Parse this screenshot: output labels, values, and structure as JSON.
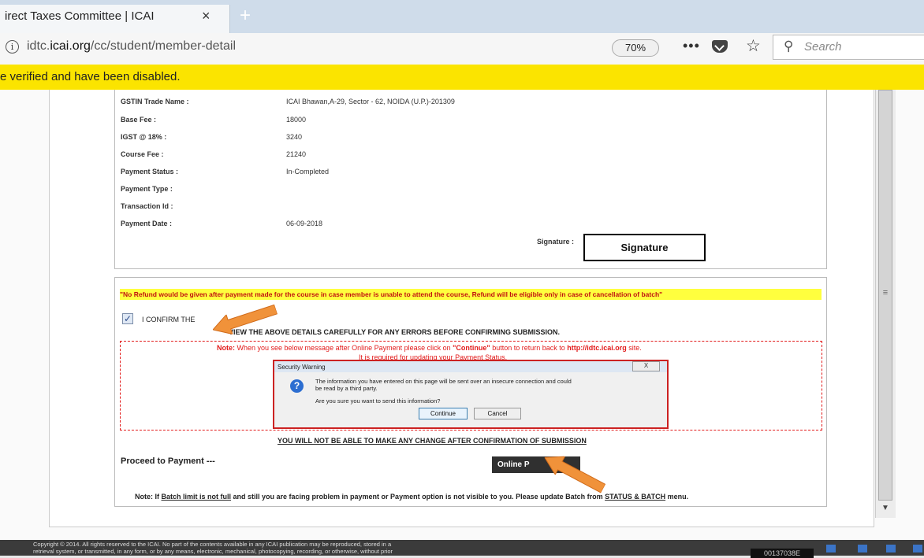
{
  "browser": {
    "tab_title": "irect Taxes Committee | ICAI",
    "tab_close": "×",
    "new_tab": "+",
    "url_prefix": "idtc.",
    "url_domain": "icai.org",
    "url_path": "/cc/student/member-detail",
    "zoom": "70%",
    "more": "•••",
    "search_placeholder": "Search"
  },
  "notification": {
    "text": "e verified and have been disabled."
  },
  "details": {
    "rows": [
      {
        "label": "GSTIN Trade Name :",
        "value": "ICAI Bhawan,A-29, Sector - 62, NOIDA (U.P.)-201309"
      },
      {
        "label": "Base Fee :",
        "value": "18000"
      },
      {
        "label": "IGST @ 18% :",
        "value": "3240"
      },
      {
        "label": "Course Fee :",
        "value": "21240"
      },
      {
        "label": "Payment Status :",
        "value": "In-Completed"
      },
      {
        "label": "Payment Type :",
        "value": ""
      },
      {
        "label": "Transaction Id :",
        "value": ""
      },
      {
        "label": "Payment Date :",
        "value": "06-09-2018"
      }
    ],
    "signature_label": "Signature :",
    "signature_box": "Signature"
  },
  "confirm": {
    "refund_notice": "\"No Refund would be given after payment made for the course in case member is unable to attend the course, Refund will be eligible only in case of cancellation of batch\"",
    "checkbox_checked": true,
    "checkbox_mark": "✓",
    "confirm_text": "I CONFIRM THE",
    "review_text": "VIEW THE ABOVE DETAILS CAREFULLY FOR ANY ERRORS BEFORE CONFIRMING SUBMISSION.",
    "note_label": "Note:",
    "note_text_a": " When you see below message after Online Payment please click on ",
    "note_continue": "\"Continue\"",
    "note_text_b": " button to return back to ",
    "note_site": "http://idtc.icai.org",
    "note_text_c": " site.",
    "note_line2": "It is required for updating your Payment Status.",
    "no_change": "YOU WILL NOT BE ABLE TO MAKE ANY CHANGE AFTER CONFIRMATION OF SUBMISSION",
    "proceed": "Proceed to Payment ---",
    "pay_button": "Online P",
    "bottom_note_label": "Note:",
    "bottom_note_a": " If ",
    "bottom_note_link": "Batch limit is not full",
    "bottom_note_b": " and still you are facing problem in payment or Payment option is not visible to you. Please update Batch from ",
    "bottom_note_menu": "STATUS & BATCH",
    "bottom_note_c": " menu."
  },
  "dialog": {
    "title": "Security Warning",
    "close": "X",
    "icon": "?",
    "message_line1": "The information you have entered on this page will be sent over an insecure connection and could",
    "message_line2": "be read by a third party.",
    "question": "Are you sure you want to send this information?",
    "continue_label": "Continue",
    "cancel_label": "Cancel"
  },
  "scrollbar": {
    "grip": "≡",
    "down": "▼"
  },
  "footer": {
    "line1": "Copyright © 2014. All rights reserved to the ICAI. No part of the contents available in any ICAI publication may be reproduced, stored in a",
    "line2": "retrieval system, or transmitted, in any form, or by any means, electronic, mechanical, photocopying, recording, or otherwise, without prior",
    "counter": "00137038E"
  },
  "colors": {
    "notification": "#fbe400",
    "arrow": "#f0923a",
    "warning_red": "#e21b1b"
  }
}
